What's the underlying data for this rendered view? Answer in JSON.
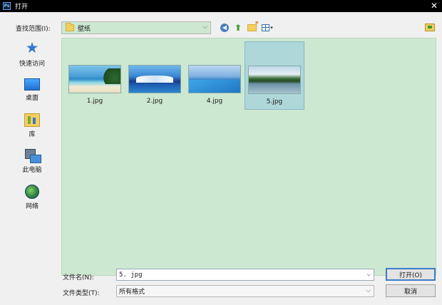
{
  "window": {
    "title": "打开",
    "app_badge": "Ps"
  },
  "toolbar": {
    "look_in_label": "查找范围(I):",
    "look_in_value": "壁纸",
    "back_icon": "back-arrow-icon",
    "up_icon": "up-folder-icon",
    "new_folder_icon": "new-folder-icon",
    "view_menu_icon": "view-menu-icon"
  },
  "places": [
    {
      "label": "快速访问",
      "icon": "star-icon"
    },
    {
      "label": "桌面",
      "icon": "desktop-icon"
    },
    {
      "label": "库",
      "icon": "library-icon"
    },
    {
      "label": "此电脑",
      "icon": "computer-icon"
    },
    {
      "label": "网络",
      "icon": "network-icon"
    }
  ],
  "files": [
    {
      "name": "1.jpg",
      "selected": false
    },
    {
      "name": "2.jpg",
      "selected": false
    },
    {
      "name": "4.jpg",
      "selected": false
    },
    {
      "name": "5.jpg",
      "selected": true
    }
  ],
  "footer": {
    "filename_label": "文件名(N):",
    "filename_value": "5. jpg",
    "filetype_label": "文件类型(T):",
    "filetype_value": "所有格式",
    "open_button": "打开(O)",
    "cancel_button": "取消"
  },
  "colors": {
    "pane_bg": "#cde8d0",
    "selected_bg": "#aed7d9",
    "primary_border": "#3d7cc8"
  }
}
